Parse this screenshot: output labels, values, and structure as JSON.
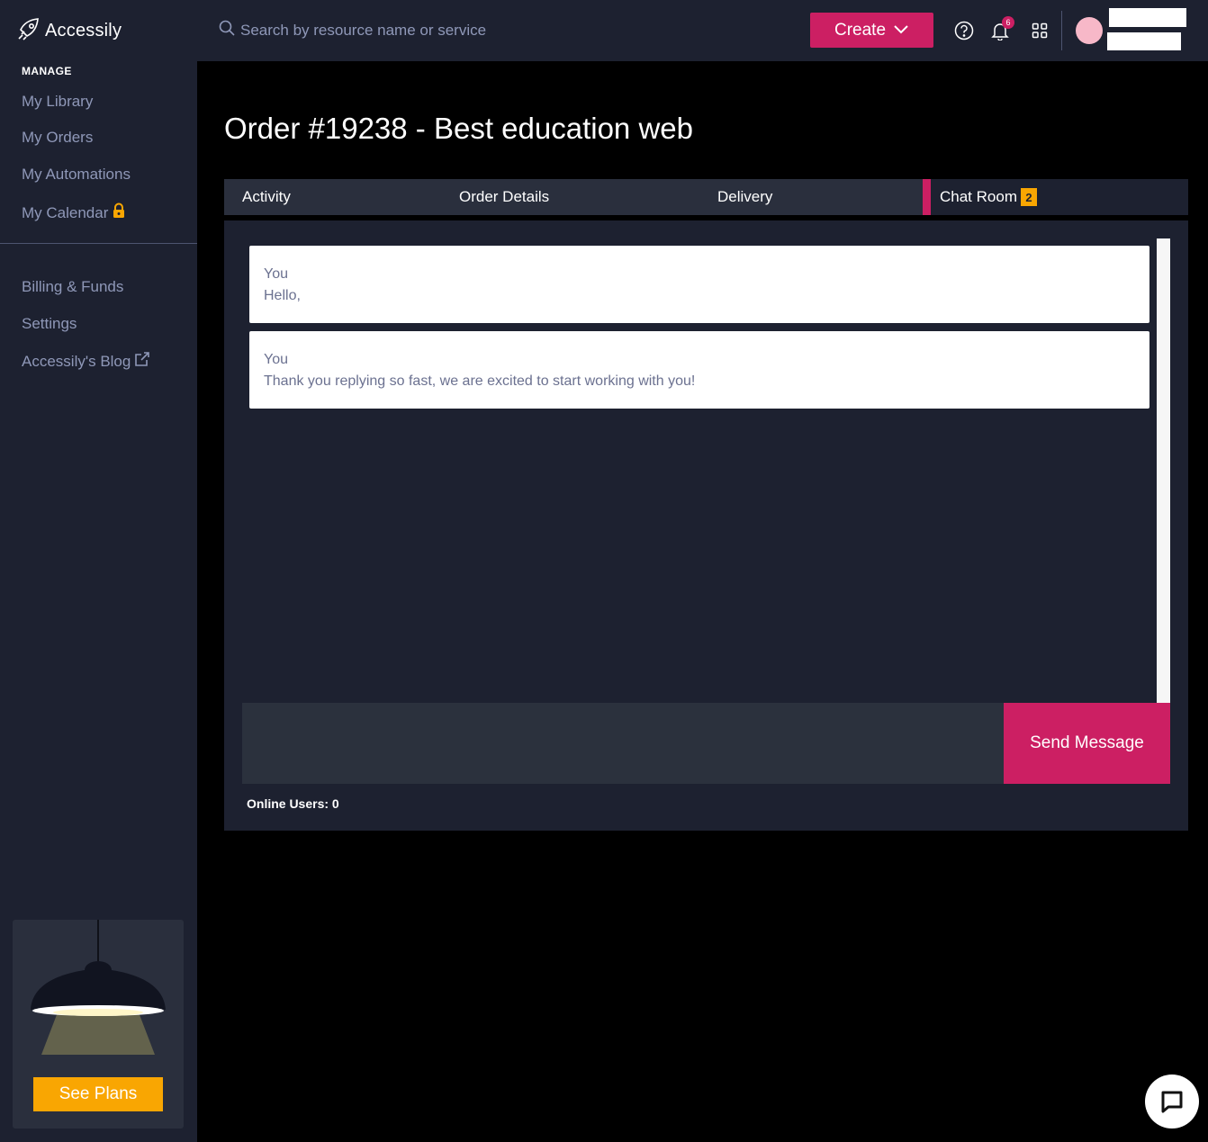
{
  "brand": {
    "name": "Accessily"
  },
  "sidebar": {
    "section_title": "MANAGE",
    "items": [
      {
        "label": "My Library"
      },
      {
        "label": "My Orders"
      },
      {
        "label": "My Automations"
      },
      {
        "label": "My Calendar",
        "icon": "lock-icon"
      },
      {
        "label": "Billing & Funds"
      },
      {
        "label": "Settings"
      },
      {
        "label": "Accessily's Blog",
        "icon": "external-link-icon"
      }
    ],
    "promo": {
      "button_label": "See Plans"
    }
  },
  "header": {
    "search_placeholder": "Search by resource name or service",
    "create_label": "Create",
    "notification_count": "6"
  },
  "page": {
    "title": "Order #19238 - Best education web",
    "tabs": [
      {
        "label": "Activity"
      },
      {
        "label": "Order Details"
      },
      {
        "label": "Delivery"
      },
      {
        "label": "Chat Room",
        "badge": "2",
        "active": true
      }
    ]
  },
  "chat": {
    "messages": [
      {
        "author": "You",
        "text": "Hello,"
      },
      {
        "author": "You",
        "text": "Thank you replying so fast, we are excited to start working with you!"
      }
    ],
    "input_value": "",
    "send_label": "Send Message",
    "online_users": "Online Users: 0"
  },
  "colors": {
    "accent": "#cc1f63",
    "warning": "#f9a602",
    "sidebar_bg": "#1d2130"
  }
}
